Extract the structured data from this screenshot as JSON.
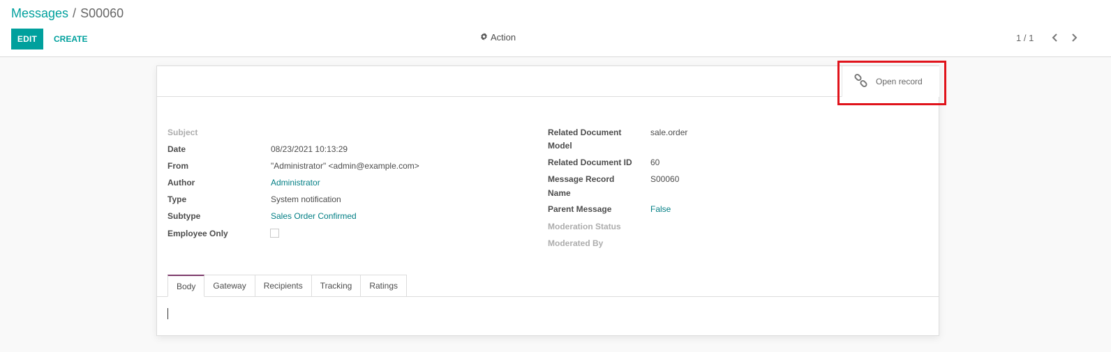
{
  "breadcrumb": {
    "parent": "Messages",
    "separator": "/",
    "current": "S00060"
  },
  "toolbar": {
    "edit_label": "EDIT",
    "create_label": "CREATE",
    "action_label": "Action",
    "action_icon": "gear-icon"
  },
  "pager": {
    "value": "1 / 1",
    "prev_icon": "chevron-left-icon",
    "next_icon": "chevron-right-icon"
  },
  "smart_button": {
    "label": "Open record",
    "icon": "link-icon",
    "highlight_color": "#e0131b"
  },
  "left_fields": {
    "subject": {
      "label": "Subject",
      "value": ""
    },
    "date": {
      "label": "Date",
      "value": "08/23/2021 10:13:29"
    },
    "from": {
      "label": "From",
      "value": "\"Administrator\" <admin@example.com>"
    },
    "author": {
      "label": "Author",
      "value": "Administrator"
    },
    "type": {
      "label": "Type",
      "value": "System notification"
    },
    "subtype": {
      "label": "Subtype",
      "value": "Sales Order Confirmed"
    },
    "employee_only": {
      "label": "Employee Only",
      "checked": false
    }
  },
  "right_fields": {
    "model": {
      "label_line1": "Related Document",
      "label_line2": "Model",
      "value": "sale.order"
    },
    "res_id": {
      "label": "Related Document ID",
      "value": "60"
    },
    "record_name": {
      "label_line1": "Message Record",
      "label_line2": "Name",
      "value": "S00060"
    },
    "parent": {
      "label": "Parent Message",
      "value": "False"
    },
    "moderation_status": {
      "label": "Moderation Status",
      "value": ""
    },
    "moderated_by": {
      "label": "Moderated By",
      "value": ""
    }
  },
  "tabs": [
    {
      "label": "Body",
      "active": true
    },
    {
      "label": "Gateway",
      "active": false
    },
    {
      "label": "Recipients",
      "active": false
    },
    {
      "label": "Tracking",
      "active": false
    },
    {
      "label": "Ratings",
      "active": false
    }
  ],
  "colors": {
    "primary": "#00a09d",
    "link": "#017e84",
    "active_tab_border": "#7c3a6b"
  }
}
